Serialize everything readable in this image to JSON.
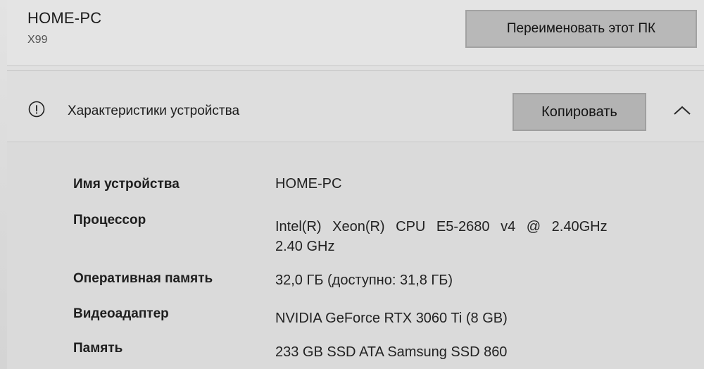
{
  "device": {
    "name": "HOME-PC",
    "model": "X99",
    "rename_button": "Переименовать этот ПК"
  },
  "specs": {
    "title": "Характеристики устройства",
    "info_icon": "info-circle-icon",
    "copy_button": "Копировать",
    "collapse_icon": "chevron-up-icon",
    "rows": [
      {
        "label": "Имя устройства",
        "value": "HOME-PC"
      },
      {
        "label": "Процессор",
        "value_line1": "Intel(R) Xeon(R) CPU E5-2680 v4 @ 2.40GHz",
        "value_line2": "2.40 GHz"
      },
      {
        "label": "Оперативная память",
        "value": "32,0 ГБ (доступно: 31,8 ГБ)"
      },
      {
        "label": "Видеоадаптер",
        "value": "NVIDIA GeForce RTX 3060 Ti (8 GB)"
      },
      {
        "label": "Память",
        "value": "233 GB SSD ATA Samsung SSD 860"
      }
    ]
  }
}
